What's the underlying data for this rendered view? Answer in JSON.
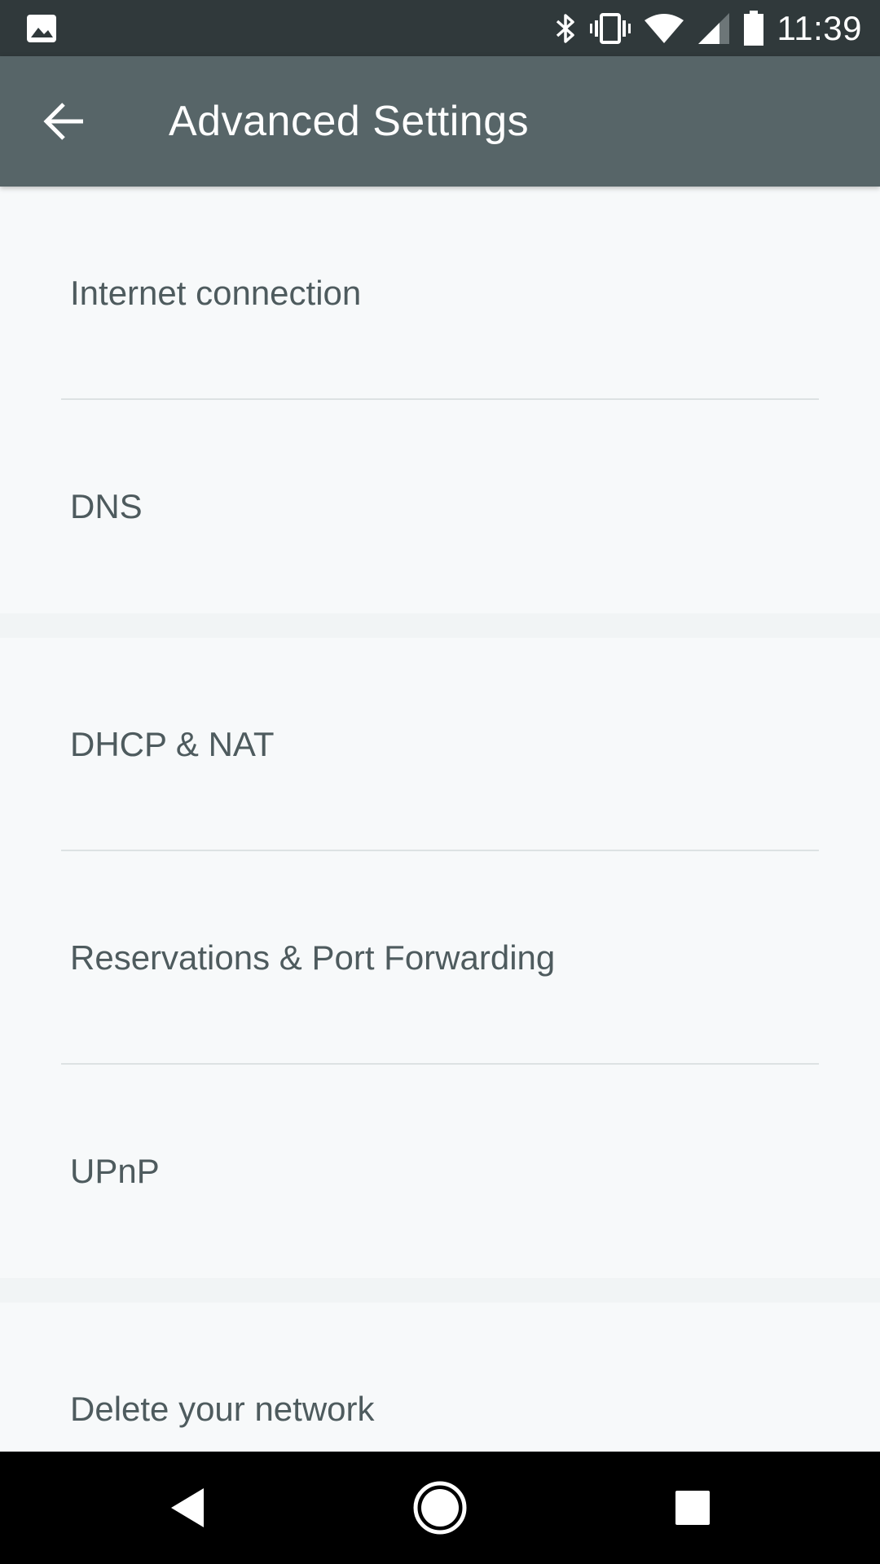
{
  "status_bar": {
    "time": "11:39",
    "icons": [
      "image-notification-icon",
      "bluetooth-icon",
      "vibrate-icon",
      "wifi-icon",
      "cell-signal-icon",
      "battery-icon"
    ]
  },
  "app_bar": {
    "title": "Advanced Settings",
    "back_icon": "arrow-back-icon"
  },
  "sections": [
    {
      "items": [
        "Internet connection",
        "DNS"
      ]
    },
    {
      "items": [
        "DHCP & NAT",
        "Reservations & Port Forwarding",
        "UPnP"
      ]
    },
    {
      "items": [
        "Delete your network"
      ]
    }
  ],
  "nav_bar": {
    "icons": [
      "nav-back-icon",
      "nav-home-icon",
      "nav-recents-icon"
    ]
  },
  "colors": {
    "status_bar": "#30393b",
    "app_bar": "#576568",
    "background": "#f7f9fa",
    "text": "#4e5b5e",
    "divider": "#dde2e3"
  }
}
